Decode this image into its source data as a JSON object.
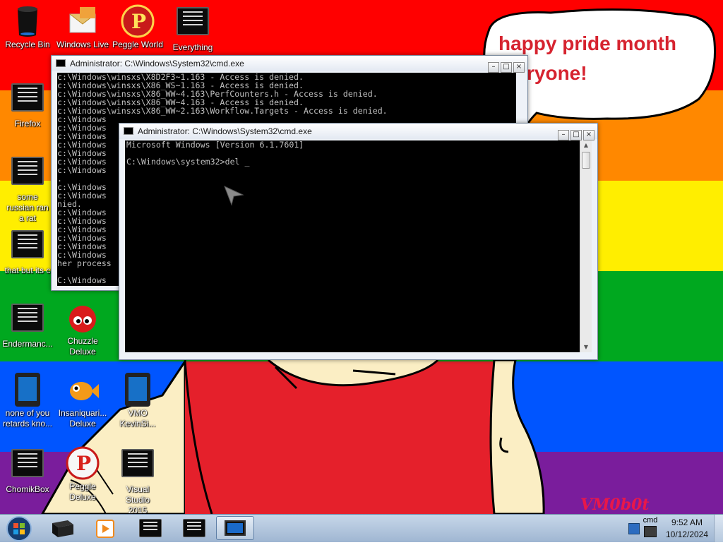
{
  "wallpaper": {
    "speech_line1": "happy pride month",
    "speech_line2": "ryone!",
    "watermark": "VM0b0t",
    "stripe_colors": [
      "#ff0000",
      "#ff8800",
      "#ffee00",
      "#00a81f",
      "#0055ff",
      "#7a1d9c"
    ]
  },
  "desktop_icons": [
    {
      "label": "Recycle Bin",
      "icon": "recycle-bin-icon"
    },
    {
      "label": "Windows Live",
      "icon": "windows-live-icon"
    },
    {
      "label": "Peggle World",
      "icon": "peggle-icon"
    },
    {
      "label": "Everything",
      "icon": "console-app-icon"
    },
    {
      "label": "Firefox",
      "icon": "console-app-icon"
    },
    {
      "label": "some russian ran a rat",
      "icon": "console-app-icon"
    },
    {
      "label": "that but its c",
      "icon": "console-app-icon"
    },
    {
      "label": "Endermanc...",
      "icon": "console-app-icon"
    },
    {
      "label": "Chuzzle Deluxe",
      "icon": "chuzzle-icon"
    },
    {
      "label": "none of you retards kno...",
      "icon": "tablet-icon"
    },
    {
      "label": "Insaniquari... Deluxe",
      "icon": "goldfish-icon"
    },
    {
      "label": "VMO KevinSi...",
      "icon": "tablet-icon"
    },
    {
      "label": "ChomikBox",
      "icon": "console-app-icon"
    },
    {
      "label": "Peggle Deluxe",
      "icon": "peggle-icon"
    },
    {
      "label": "Visual Studio 2015",
      "icon": "console-app-icon"
    }
  ],
  "back_window": {
    "title": "Administrator: C:\\Windows\\System32\\cmd.exe",
    "lines": [
      "c:\\Windows\\winsxs\\X8D2F3~1.163 - Access is denied.",
      "c:\\Windows\\winsxs\\X86_WS~1.163 - Access is denied.",
      "c:\\Windows\\winsxs\\X86_WW~4.163\\PerfCounters.h - Access is denied.",
      "c:\\Windows\\winsxs\\X86_WW~4.163 - Access is denied.",
      "c:\\Windows\\winsxs\\X86_WW~2.163\\Workflow.Targets - Access is denied.",
      "c:\\Windows",
      "c:\\Windows",
      "c:\\Windows",
      "c:\\Windows",
      "c:\\Windows",
      "c:\\Windows",
      "c:\\Windows",
      ".",
      "c:\\Windows",
      "c:\\Windows",
      "nied.",
      "c:\\Windows",
      "c:\\Windows",
      "c:\\Windows",
      "c:\\Windows",
      "c:\\Windows",
      "c:\\Windows",
      "her process",
      "",
      "C:\\Windows"
    ]
  },
  "front_window": {
    "title": "Administrator: C:\\Windows\\System32\\cmd.exe",
    "lines": [
      "Microsoft Windows [Version 6.1.7601]",
      "",
      "C:\\Windows\\system32>del _"
    ]
  },
  "taskbar": {
    "tray_label": "cmd",
    "time": "9:52 AM",
    "date": "10/12/2024",
    "buttons": [
      "console-taskbar-button",
      "media-player-taskbar-button",
      "cmd-taskbar-button",
      "cmd-taskbar-button",
      "active-window-taskbar-button"
    ]
  }
}
